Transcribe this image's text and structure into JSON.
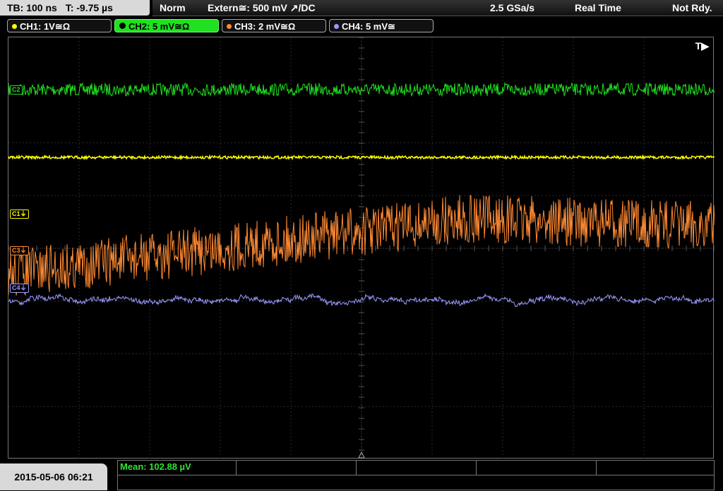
{
  "header": {
    "timebase": "TB: 100 ns",
    "trigger_time": "T: -9.75 µs",
    "mode": "Norm",
    "trigger_source": "Extern≅: 500 mV ↗/DC",
    "sample_rate": "2.5 GSa/s",
    "acq_mode": "Real Time",
    "status": "Not Rdy."
  },
  "channels": [
    {
      "label": "CH1: 1V≅Ω",
      "color": "#ffff00",
      "active": false
    },
    {
      "label": "CH2: 5 mV≅Ω",
      "color": "#1fe11f",
      "active": true
    },
    {
      "label": "CH3: 2 mV≅Ω",
      "color": "#ff8a33",
      "active": false
    },
    {
      "label": "CH4: 5 mV≅",
      "color": "#9a9aff",
      "active": false
    }
  ],
  "display": {
    "trigger_tag": "T▶",
    "markers": {
      "c2": "C2",
      "c1": "C1⏚",
      "c3": "C3⏚",
      "c4": "C4⏚"
    }
  },
  "footer": {
    "datetime": "2015-05-06 06:21",
    "measurement": "Mean: 102.88 µV"
  }
}
